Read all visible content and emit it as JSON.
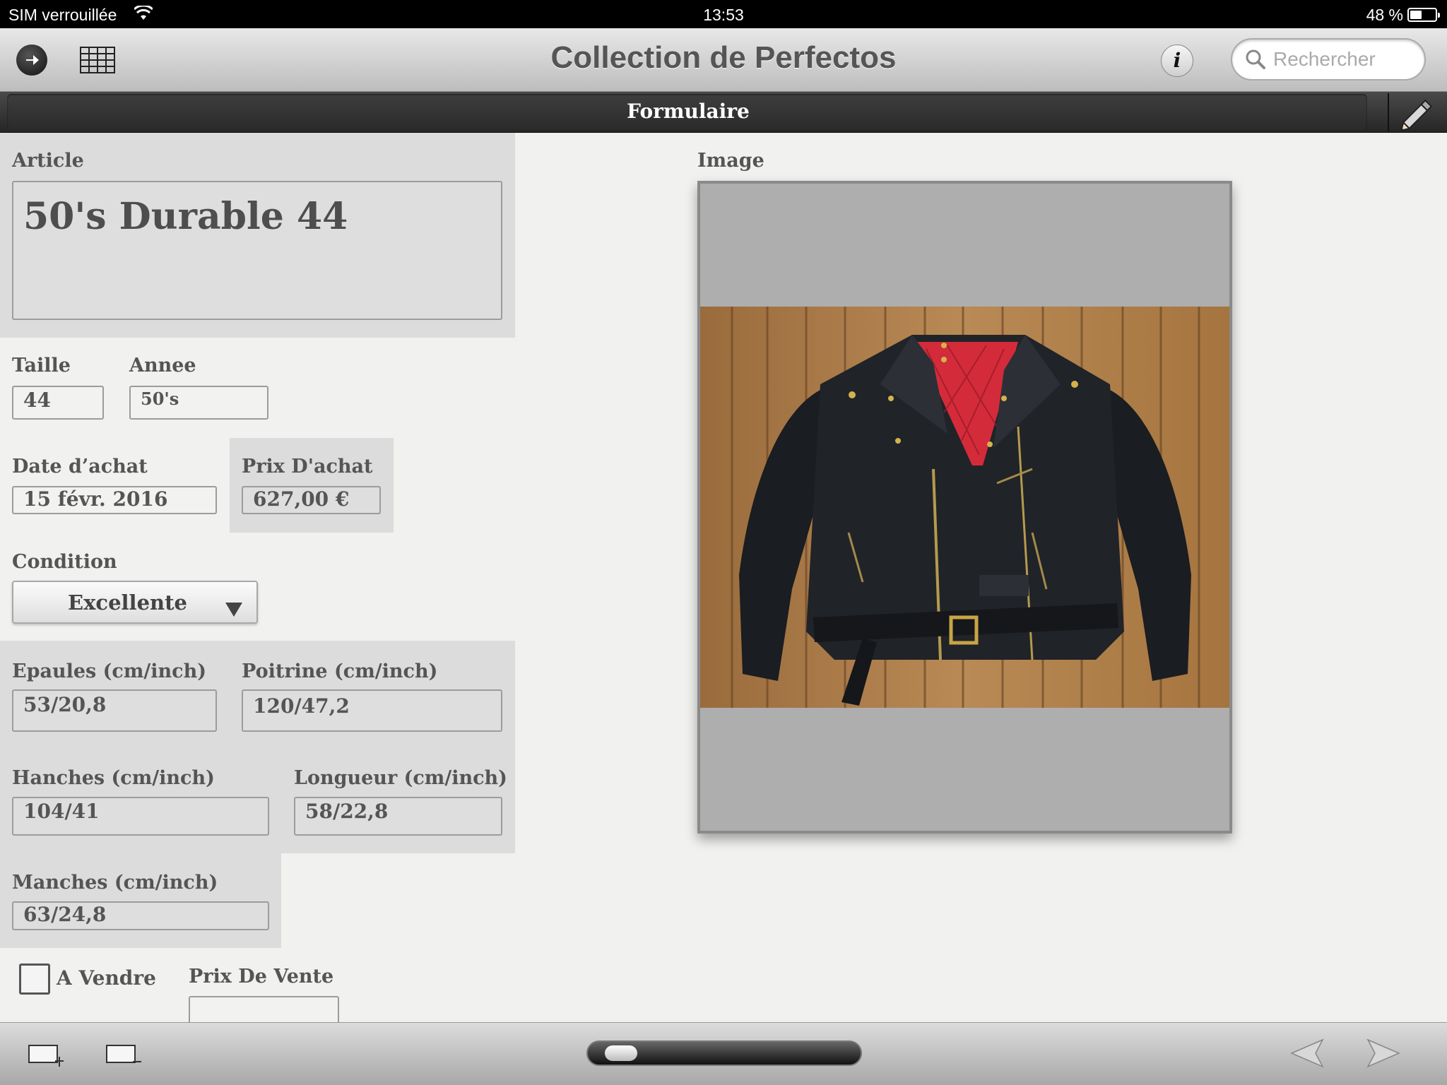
{
  "status_bar": {
    "carrier": "SIM verrouillée",
    "time": "13:53",
    "battery": "48 %",
    "battery_level": 0.48
  },
  "nav": {
    "title": "Collection de Perfectos",
    "info_glyph": "i",
    "search_placeholder": "Rechercher",
    "forward_icon": "forward-arrow-icon",
    "grid_icon": "table-grid-icon"
  },
  "section": {
    "title": "Formulaire",
    "edit_icon": "pencil-icon"
  },
  "form": {
    "article": {
      "label": "Article",
      "value": "50's Durable 44"
    },
    "taille": {
      "label": "Taille",
      "value": "44"
    },
    "annee": {
      "label": "Annee",
      "value": "50's"
    },
    "date_achat": {
      "label": "Date d’achat",
      "value": "15 févr. 2016"
    },
    "prix_achat": {
      "label": "Prix D'achat",
      "value": "627,00 €"
    },
    "condition": {
      "label": "Condition",
      "value": "Excellente"
    },
    "epaules": {
      "label": "Epaules (cm/inch)",
      "value": "53/20,8"
    },
    "poitrine": {
      "label": "Poitrine (cm/inch)",
      "value": "120/47,2"
    },
    "hanches": {
      "label": "Hanches (cm/inch)",
      "value": "104/41"
    },
    "longueur": {
      "label": "Longueur (cm/inch)",
      "value": "58/22,8"
    },
    "manches": {
      "label": "Manches (cm/inch)",
      "value": "63/24,8"
    },
    "a_vendre": {
      "label": "A Vendre",
      "checked": false
    },
    "prix_vente": {
      "label": "Prix De Vente",
      "value": ""
    }
  },
  "image": {
    "label": "Image",
    "description_icon": "leather-jacket-photo"
  },
  "toolbar": {
    "add_icon": "add-record-icon",
    "remove_icon": "remove-record-icon",
    "prev_icon": "previous-arrow-icon",
    "next_icon": "next-arrow-icon",
    "record_position": 0.05
  },
  "colors": {
    "panel_bg": "#dcdcdc",
    "page_bg": "#f1f1f0",
    "section_bar": "#2f2f2f"
  }
}
